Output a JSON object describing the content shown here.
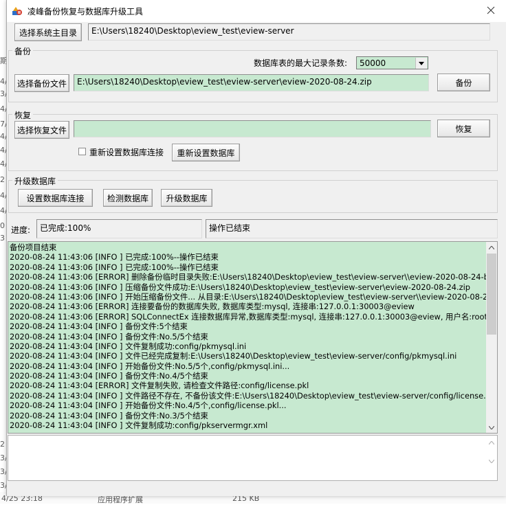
{
  "window": {
    "title": "凌峰备份恢复与数据库升级工具"
  },
  "paths": {
    "main_dir_button": "选择系统主目录",
    "main_dir_value": "E:\\Users\\18240\\Desktop\\eview_test\\eview-server"
  },
  "backup": {
    "group_label": "备份",
    "max_records_label": "数据库表的最大记录条数:",
    "max_records_value": "50000",
    "select_file_button": "选择备份文件",
    "file_value": "E:\\Users\\18240\\Desktop\\eview_test\\eview-server\\eview-2020-08-24.zip",
    "backup_button": "备份"
  },
  "restore": {
    "group_label": "恢复",
    "select_file_button": "选择恢复文件",
    "file_value": "",
    "restore_button": "恢复",
    "reset_conn_checkbox_label": "重新设置数据库连接",
    "reset_db_button": "重新设置数据库"
  },
  "upgrade": {
    "group_label": "升级数据库",
    "set_conn_button": "设置数据库连接",
    "check_db_button": "检测数据库",
    "upgrade_db_button": "升级数据库"
  },
  "progress": {
    "label": "进度:",
    "value": "已完成:100%",
    "status": "操作已结束"
  },
  "log": [
    "备份项目结束",
    "2020-08-24 11:43:06 [INFO ] 已完成:100%--操作已结束",
    "2020-08-24 11:43:06 [INFO ] 已完成:100%--操作已结束",
    "2020-08-24 11:43:06 [ERROR] 删除备份临时目录失败:E:\\Users\\18240\\Desktop\\eview_test\\eview-server\\\\eview-2020-08-24-backup-",
    "2020-08-24 11:43:06 [INFO ] 压缩备份文件成功:E:\\Users\\18240\\Desktop\\eview_test\\eview-server\\eview-2020-08-24.zip",
    "2020-08-24 11:43:06 [INFO ] 开始压缩备份文件... 从目录:E:\\Users\\18240\\Desktop\\eview_test\\eview-server\\\\eview-2020-08-24-bac",
    "2020-08-24 11:43:06 [ERROR] 连接要备份的数据库失败, 数据库类型:mysql, 连接串:127.0.0.1:30003@eview",
    "2020-08-24 11:43:06 [ERROR] SQLConnectEx 连接数据库异常,数据库类型:mysql, 连接串:127.0.0.1:30003@eview, 用户名:root,Erro",
    "2020-08-24 11:43:04 [INFO ] 备份文件:5个结束",
    "2020-08-24 11:43:04 [INFO ] 备份文件:No.5/5个结束",
    "2020-08-24 11:43:04 [INFO ] 文件复制成功:config/pkmysql.ini",
    "2020-08-24 11:43:04 [INFO ] 文件已经完成复制:E:\\Users\\18240\\Desktop\\eview_test\\eview-server/config/pkmysql.ini",
    "2020-08-24 11:43:04 [INFO ] 开始备份文件:No.5/5个,config/pkmysql.ini...",
    "2020-08-24 11:43:04 [INFO ] 备份文件:No.4/5个结束",
    "2020-08-24 11:43:04 [ERROR] 文件复制失败, 请检查文件路径:config/license.pkl",
    "2020-08-24 11:43:04 [INFO ] 文件路径不存在, 不备份该文件:E:\\Users\\18240\\Desktop\\eview_test\\eview-server/config/license.pkl, 不",
    "2020-08-24 11:43:04 [INFO ] 开始备份文件:No.4/5个,config/license.pkl...",
    "2020-08-24 11:43:04 [INFO ] 备份文件:No.3/5个结束",
    "2020-08-24 11:43:04 [INFO ] 文件复制成功:config/pkservermgr.xml"
  ],
  "background": {
    "digits": [
      "期",
      "4/",
      "3/",
      "4/",
      "7/",
      "4/",
      "4/",
      "4/",
      "4/",
      "4/",
      "4/",
      "2",
      "4/",
      "4/",
      "0",
      "3",
      "4/",
      "3/",
      "4/",
      "2/",
      "2",
      "3/",
      "3/",
      "3/",
      "3/"
    ],
    "bottom_time": "4/25 23:18",
    "bottom_type": "应用程序扩展",
    "bottom_size": "215 KB"
  }
}
